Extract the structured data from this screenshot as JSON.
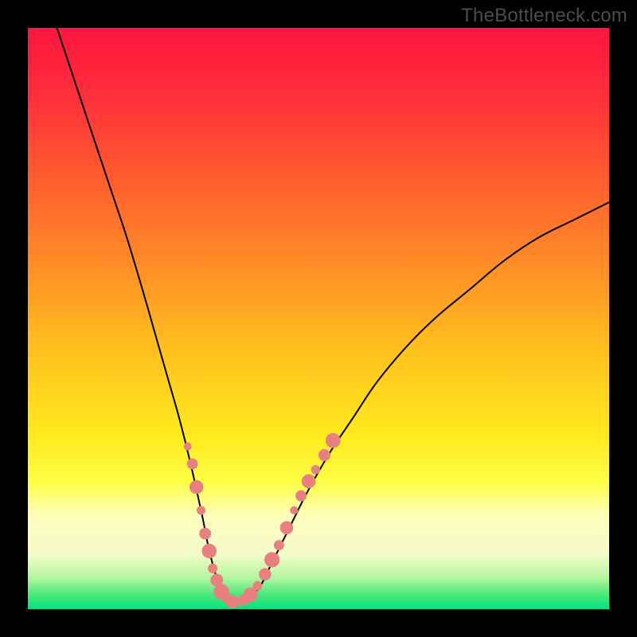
{
  "watermark": "TheBottleneck.com",
  "frame": {
    "outer_size": 800,
    "inner_left": 35,
    "inner_top": 35,
    "inner_size": 730,
    "border_color": "#000000"
  },
  "gradient": {
    "stops": [
      {
        "offset": 0.0,
        "color": "#ff1540"
      },
      {
        "offset": 0.12,
        "color": "#ff2f3a"
      },
      {
        "offset": 0.25,
        "color": "#ff5a2f"
      },
      {
        "offset": 0.4,
        "color": "#ff8a27"
      },
      {
        "offset": 0.55,
        "color": "#ffbf1e"
      },
      {
        "offset": 0.7,
        "color": "#ffe91e"
      },
      {
        "offset": 0.78,
        "color": "#fdfd44"
      },
      {
        "offset": 0.84,
        "color": "#fdfdbc"
      },
      {
        "offset": 0.905,
        "color": "#f4fbca"
      },
      {
        "offset": 0.945,
        "color": "#b7f6a0"
      },
      {
        "offset": 0.975,
        "color": "#4be879"
      },
      {
        "offset": 1.0,
        "color": "#00e480"
      }
    ]
  },
  "chart_data": {
    "type": "line",
    "title": "",
    "xlabel": "",
    "ylabel": "",
    "xlim": [
      0,
      100
    ],
    "ylim": [
      0,
      100
    ],
    "grid": false,
    "series": [
      {
        "name": "bottleneck-curve",
        "color": "#000000",
        "width": 2,
        "x": [
          5,
          8,
          11,
          14,
          17,
          20,
          22,
          24,
          26,
          28,
          30,
          31,
          32,
          33,
          34,
          35,
          36,
          38,
          40,
          42,
          45,
          48,
          52,
          56,
          60,
          65,
          70,
          76,
          82,
          88,
          94,
          100
        ],
        "y": [
          100,
          91,
          82,
          73,
          64,
          54,
          47,
          40,
          33,
          25,
          16,
          11,
          7,
          4,
          2,
          1,
          1,
          2,
          4,
          8,
          14,
          20,
          27,
          33,
          39,
          45,
          50,
          55,
          60,
          64,
          67,
          70
        ]
      }
    ],
    "markers": {
      "name": "highlight-dots",
      "color": "#e98080",
      "radius_range": [
        5,
        10
      ],
      "points": [
        {
          "x": 27.5,
          "y": 28
        },
        {
          "x": 28.3,
          "y": 25
        },
        {
          "x": 29.0,
          "y": 21
        },
        {
          "x": 29.8,
          "y": 17
        },
        {
          "x": 30.5,
          "y": 13
        },
        {
          "x": 31.2,
          "y": 10
        },
        {
          "x": 31.8,
          "y": 7
        },
        {
          "x": 32.5,
          "y": 5
        },
        {
          "x": 33.3,
          "y": 3
        },
        {
          "x": 34.2,
          "y": 2
        },
        {
          "x": 35.2,
          "y": 1.3
        },
        {
          "x": 36.2,
          "y": 1.2
        },
        {
          "x": 37.2,
          "y": 1.6
        },
        {
          "x": 38.3,
          "y": 2.5
        },
        {
          "x": 39.5,
          "y": 4
        },
        {
          "x": 40.8,
          "y": 6
        },
        {
          "x": 42.0,
          "y": 8.5
        },
        {
          "x": 43.2,
          "y": 11
        },
        {
          "x": 44.5,
          "y": 14
        },
        {
          "x": 45.8,
          "y": 17
        },
        {
          "x": 47.0,
          "y": 19.5
        },
        {
          "x": 48.3,
          "y": 22
        },
        {
          "x": 49.5,
          "y": 24
        },
        {
          "x": 51.0,
          "y": 26.5
        },
        {
          "x": 52.5,
          "y": 29
        }
      ]
    }
  }
}
